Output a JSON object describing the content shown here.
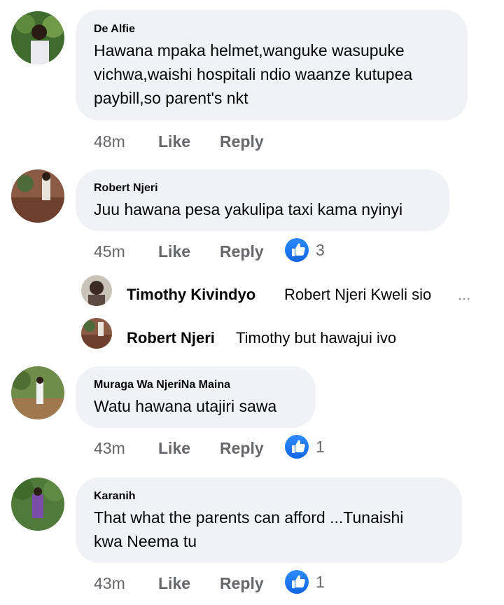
{
  "comments": [
    {
      "author": "De Alfie",
      "lines": [
        "Hawana mpaka helmet,wanguke wasupuke",
        "vichwa,waishi hospitali ndio waanze kutupea",
        "paybill,so parent's nkt"
      ],
      "time": "48m",
      "like_label": "Like",
      "reply_label": "Reply",
      "reaction_count": ""
    },
    {
      "author": "Robert Njeri",
      "lines": [
        "Juu hawana pesa yakulipa taxi kama nyinyi"
      ],
      "time": "45m",
      "like_label": "Like",
      "reply_label": "Reply",
      "reaction_count": "3"
    },
    {
      "author": "Muraga Wa NjeriNa Maina",
      "lines": [
        "Watu hawana utajiri sawa"
      ],
      "time": "43m",
      "like_label": "Like",
      "reply_label": "Reply",
      "reaction_count": "1"
    },
    {
      "author": "Karanih",
      "lines": [
        "That what the parents  can afford ...Tunaishi",
        "kwa Neema tu"
      ],
      "time": "43m",
      "like_label": "Like",
      "reply_label": "Reply",
      "reaction_count": "1"
    }
  ],
  "replies": [
    {
      "author": "Timothy Kivindyo",
      "text": "Robert Njeri Kweli sio",
      "ellipsis": "..."
    },
    {
      "author": "Robert Njeri",
      "text": "Timothy but hawajui ivo"
    }
  ],
  "colors": {
    "bubble": "#f0f2f5",
    "meta": "#65676b",
    "like_blue": "#1877f2"
  },
  "icons": {
    "reaction": "thumbs-up-icon"
  }
}
